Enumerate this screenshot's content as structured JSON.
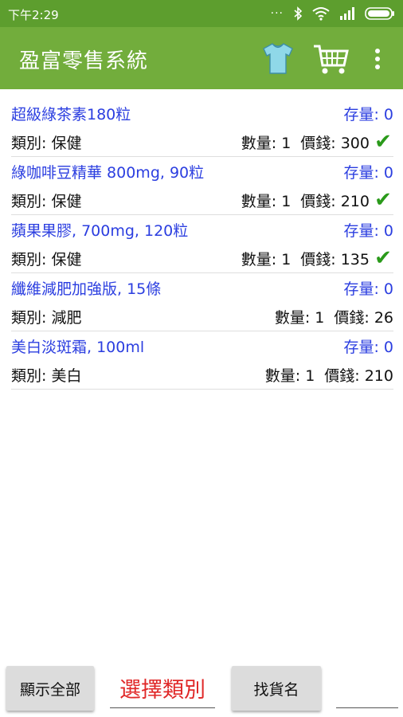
{
  "status_bar": {
    "time": "下午2:29"
  },
  "app_bar": {
    "title": "盈富零售系統"
  },
  "products": [
    {
      "name": "超級綠茶素180粒",
      "stock_label": "存量: 0",
      "category_label": "類別: 保健",
      "qty_label": "數量: 1",
      "price_label": "價錢: 300",
      "checked": true
    },
    {
      "name": "綠咖啡豆精華 800mg, 90粒",
      "stock_label": "存量: 0",
      "category_label": "類別: 保健",
      "qty_label": "數量: 1",
      "price_label": "價錢: 210",
      "checked": true
    },
    {
      "name": "蘋果果膠, 700mg, 120粒",
      "stock_label": "存量: 0",
      "category_label": "類別: 保健",
      "qty_label": "數量: 1",
      "price_label": "價錢: 135",
      "checked": true
    },
    {
      "name": "纖維減肥加強版, 15條",
      "stock_label": "存量: 0",
      "category_label": "類別: 減肥",
      "qty_label": "數量: 1",
      "price_label": "價錢: 26",
      "checked": false
    },
    {
      "name": "美白淡斑霜, 100ml",
      "stock_label": "存量: 0",
      "category_label": "類別: 美白",
      "qty_label": "數量: 1",
      "price_label": "價錢: 210",
      "checked": false
    }
  ],
  "bottom_bar": {
    "show_all_label": "顯示全部",
    "select_category_label": "選擇類別",
    "find_name_label": "找貨名"
  },
  "colors": {
    "status_bar": "#5d9e2e",
    "app_bar": "#72ad3c",
    "product_name": "#2b3ee0",
    "check": "#2a9a1a",
    "category_select": "#e02828"
  }
}
